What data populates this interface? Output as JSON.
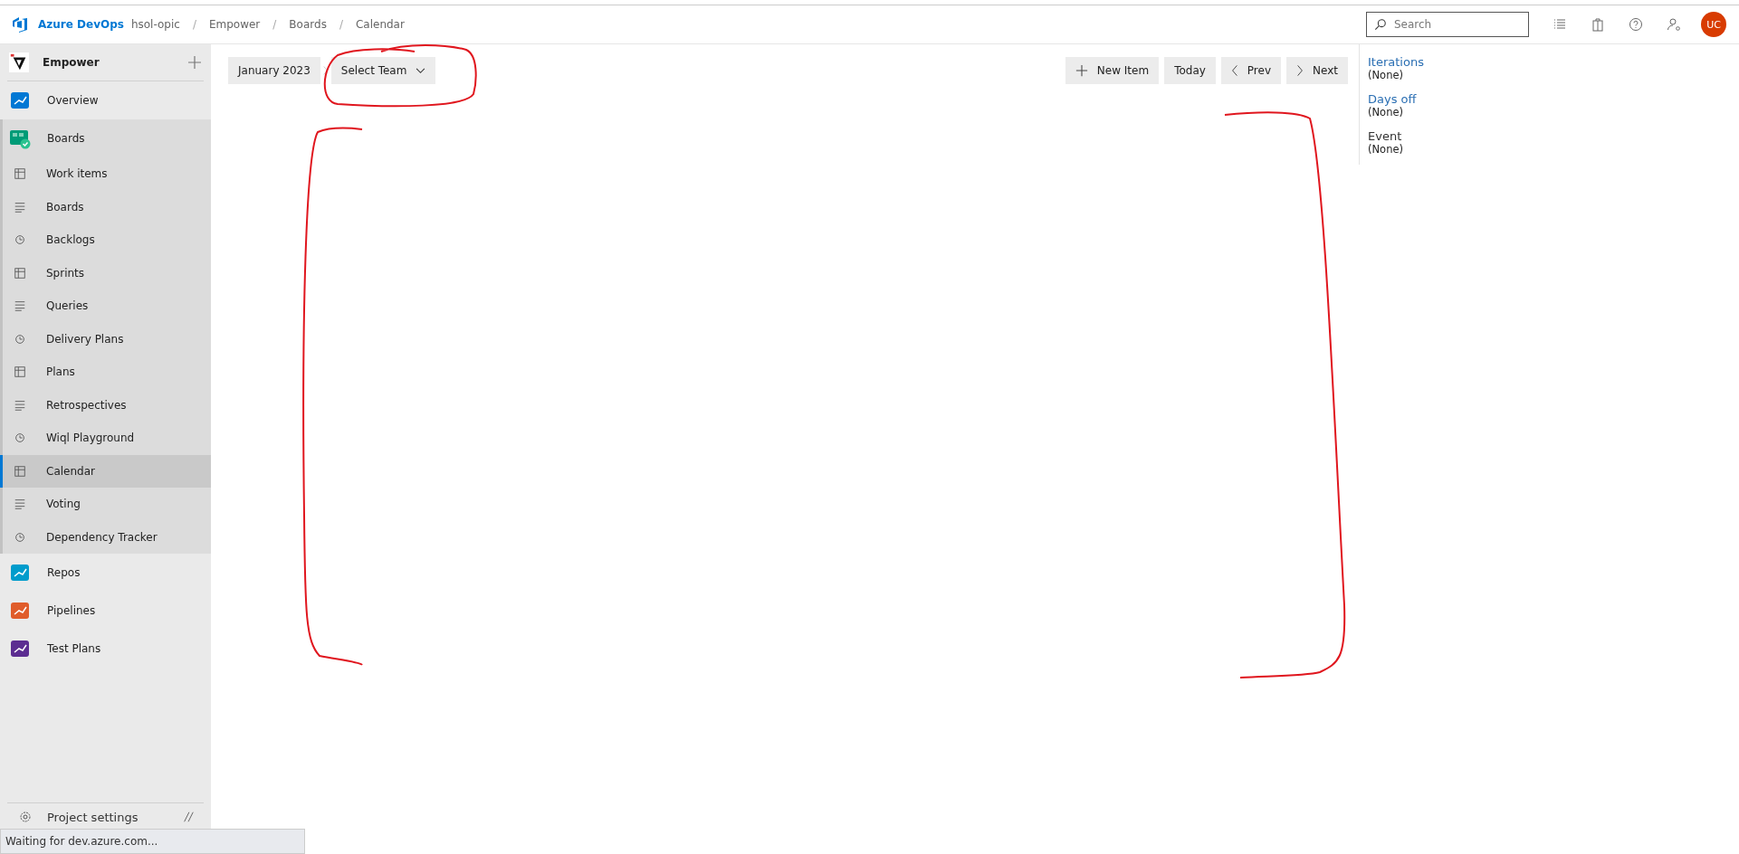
{
  "header": {
    "product": "Azure DevOps",
    "breadcrumbs": [
      {
        "label": "hsol-opic"
      },
      {
        "label": "Empower",
        "separator": "/"
      },
      {
        "label": "Boards",
        "separator": "/"
      },
      {
        "label": "Calendar",
        "separator": "/"
      }
    ],
    "search": {
      "placeholder": "Search"
    },
    "avatar": "UC"
  },
  "sidebar": {
    "project": "Empower",
    "items": [
      {
        "label": "Overview",
        "selected": false
      },
      {
        "label": "Boards",
        "selected": false,
        "expanded": true,
        "children": [
          {
            "label": "Work items",
            "selected": false
          },
          {
            "label": "Boards",
            "selected": false
          },
          {
            "label": "Backlogs",
            "selected": false
          },
          {
            "label": "Sprints",
            "selected": false
          },
          {
            "label": "Queries",
            "selected": false
          },
          {
            "label": "Delivery Plans",
            "selected": false
          },
          {
            "label": "Plans",
            "selected": false
          },
          {
            "label": "Retrospectives",
            "selected": false
          },
          {
            "label": "Wiql Playground",
            "selected": false
          },
          {
            "label": "Calendar",
            "selected": true
          },
          {
            "label": "Voting",
            "selected": false
          },
          {
            "label": "Dependency Tracker",
            "selected": false
          }
        ]
      },
      {
        "label": "Repos",
        "selected": false
      },
      {
        "label": "Pipelines",
        "selected": false
      },
      {
        "label": "Test Plans",
        "selected": false
      }
    ],
    "settings": "Project settings"
  },
  "toolbar": {
    "month": "January 2023",
    "team": "Select Team",
    "new_item": "New Item",
    "today": "Today",
    "prev": "Prev",
    "next": "Next"
  },
  "legend": [
    {
      "title": "Iterations",
      "value": "(None)",
      "kind": "link"
    },
    {
      "title": "Days off",
      "value": "(None)",
      "kind": "link"
    },
    {
      "title": "Event",
      "value": "(None)",
      "kind": "plain"
    }
  ],
  "status_bar": "Waiting for dev.azure.com..."
}
